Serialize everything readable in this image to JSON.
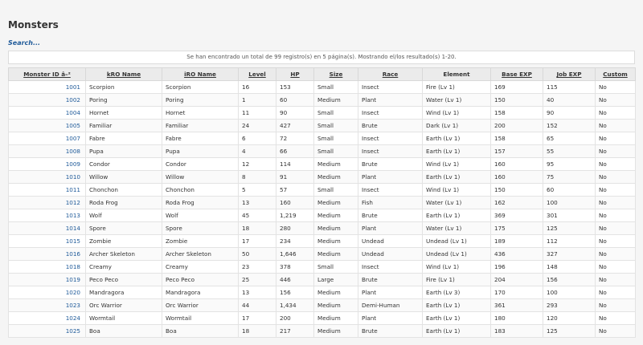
{
  "page": {
    "title": "Monsters",
    "search_label": "Search...",
    "info": "Se han encontrado un total de 99 registro(s) en 5 página(s). Mostrando el/los resultado(s) 1-20."
  },
  "table": {
    "headers": [
      "Monster ID â–²",
      "kRO Name",
      "iRO Name",
      "Level",
      "HP",
      "Size",
      "Race",
      "Element",
      "Base EXP",
      "Job EXP",
      "Custom"
    ],
    "rows": [
      [
        "1001",
        "Scorpion",
        "Scorpion",
        "16",
        "153",
        "Small",
        "Insect",
        "Fire (Lv 1)",
        "169",
        "115",
        "No"
      ],
      [
        "1002",
        "Poring",
        "Poring",
        "1",
        "60",
        "Medium",
        "Plant",
        "Water (Lv 1)",
        "150",
        "40",
        "No"
      ],
      [
        "1004",
        "Hornet",
        "Hornet",
        "11",
        "90",
        "Small",
        "Insect",
        "Wind (Lv 1)",
        "158",
        "90",
        "No"
      ],
      [
        "1005",
        "Familiar",
        "Familiar",
        "24",
        "427",
        "Small",
        "Brute",
        "Dark (Lv 1)",
        "200",
        "152",
        "No"
      ],
      [
        "1007",
        "Fabre",
        "Fabre",
        "6",
        "72",
        "Small",
        "Insect",
        "Earth (Lv 1)",
        "158",
        "65",
        "No"
      ],
      [
        "1008",
        "Pupa",
        "Pupa",
        "4",
        "66",
        "Small",
        "Insect",
        "Earth (Lv 1)",
        "157",
        "55",
        "No"
      ],
      [
        "1009",
        "Condor",
        "Condor",
        "12",
        "114",
        "Medium",
        "Brute",
        "Wind (Lv 1)",
        "160",
        "95",
        "No"
      ],
      [
        "1010",
        "Willow",
        "Willow",
        "8",
        "91",
        "Medium",
        "Plant",
        "Earth (Lv 1)",
        "160",
        "75",
        "No"
      ],
      [
        "1011",
        "Chonchon",
        "Chonchon",
        "5",
        "57",
        "Small",
        "Insect",
        "Wind (Lv 1)",
        "150",
        "60",
        "No"
      ],
      [
        "1012",
        "Roda Frog",
        "Roda Frog",
        "13",
        "160",
        "Medium",
        "Fish",
        "Water (Lv 1)",
        "162",
        "100",
        "No"
      ],
      [
        "1013",
        "Wolf",
        "Wolf",
        "45",
        "1,219",
        "Medium",
        "Brute",
        "Earth (Lv 1)",
        "369",
        "301",
        "No"
      ],
      [
        "1014",
        "Spore",
        "Spore",
        "18",
        "280",
        "Medium",
        "Plant",
        "Water (Lv 1)",
        "175",
        "125",
        "No"
      ],
      [
        "1015",
        "Zombie",
        "Zombie",
        "17",
        "234",
        "Medium",
        "Undead",
        "Undead (Lv 1)",
        "189",
        "112",
        "No"
      ],
      [
        "1016",
        "Archer Skeleton",
        "Archer Skeleton",
        "50",
        "1,646",
        "Medium",
        "Undead",
        "Undead (Lv 1)",
        "436",
        "327",
        "No"
      ],
      [
        "1018",
        "Creamy",
        "Creamy",
        "23",
        "378",
        "Small",
        "Insect",
        "Wind (Lv 1)",
        "196",
        "148",
        "No"
      ],
      [
        "1019",
        "Peco Peco",
        "Peco Peco",
        "25",
        "446",
        "Large",
        "Brute",
        "Fire (Lv 1)",
        "204",
        "156",
        "No"
      ],
      [
        "1020",
        "Mandragora",
        "Mandragora",
        "13",
        "156",
        "Medium",
        "Plant",
        "Earth (Lv 3)",
        "170",
        "100",
        "No"
      ],
      [
        "1023",
        "Orc Warrior",
        "Orc Warrior",
        "44",
        "1,434",
        "Medium",
        "Demi-Human",
        "Earth (Lv 1)",
        "361",
        "293",
        "No"
      ],
      [
        "1024",
        "Wormtail",
        "Wormtail",
        "17",
        "200",
        "Medium",
        "Plant",
        "Earth (Lv 1)",
        "180",
        "120",
        "No"
      ],
      [
        "1025",
        "Boa",
        "Boa",
        "18",
        "217",
        "Medium",
        "Brute",
        "Earth (Lv 1)",
        "183",
        "125",
        "No"
      ]
    ]
  },
  "colors": {
    "link": "#1f5a99",
    "header_bg": "#ebebeb",
    "page_bg": "#f5f5f5"
  }
}
